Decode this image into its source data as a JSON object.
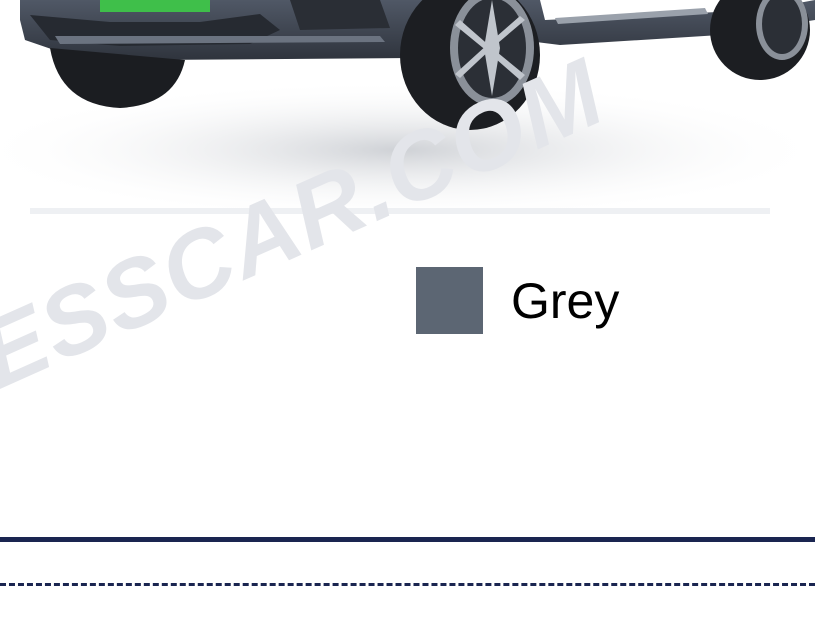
{
  "watermark": {
    "text": "LESSCAR.COM"
  },
  "color_option": {
    "label": "Grey",
    "swatch_color": "#5c6673"
  },
  "colors": {
    "divider": "#1a2550",
    "car_body": "#3e4450",
    "plate_green": "#3fbf4a"
  }
}
